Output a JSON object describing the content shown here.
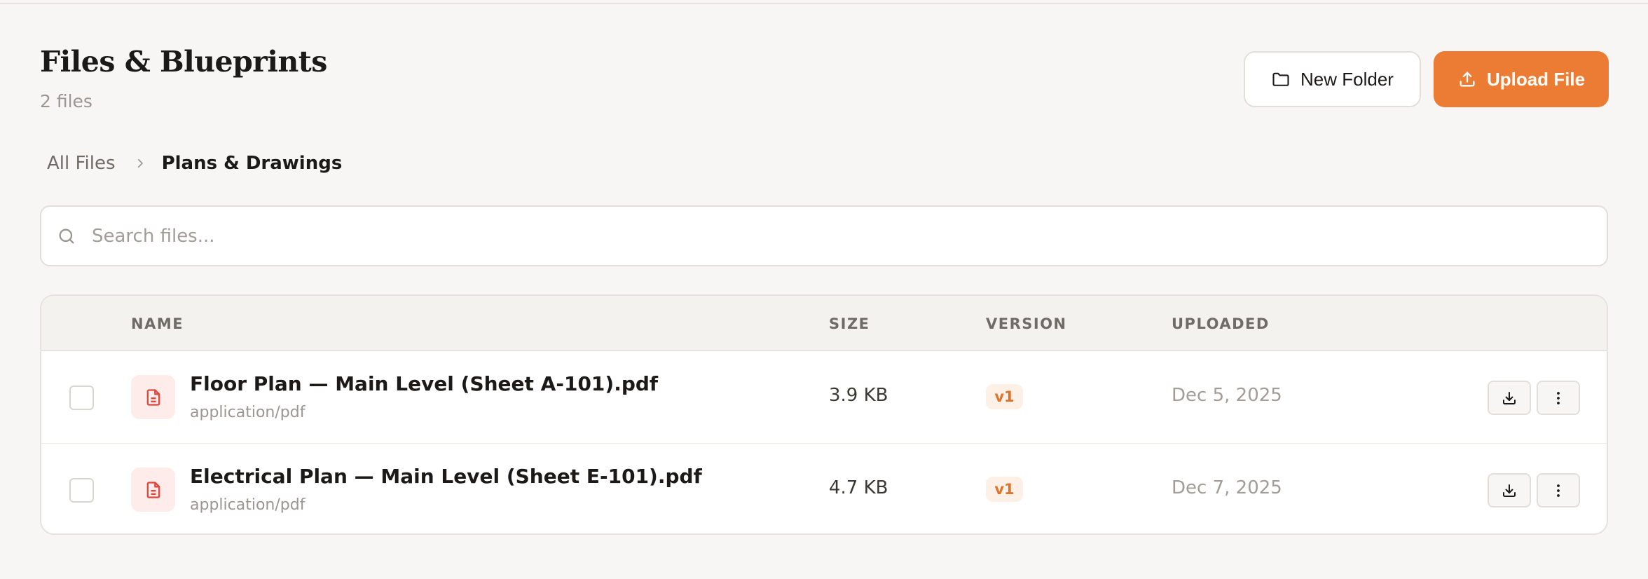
{
  "header": {
    "title": "Files & Blueprints",
    "subtitle": "2 files"
  },
  "toolbar": {
    "new_folder_label": "New Folder",
    "upload_label": "Upload File"
  },
  "breadcrumb": {
    "root": "All Files",
    "current": "Plans & Drawings"
  },
  "search": {
    "placeholder": "Search files..."
  },
  "table": {
    "columns": [
      "NAME",
      "SIZE",
      "VERSION",
      "UPLOADED"
    ],
    "rows": [
      {
        "name": "Floor Plan — Main Level (Sheet A-101).pdf",
        "type": "application/pdf",
        "size": "3.9 KB",
        "version": "v1",
        "uploaded": "Dec 5, 2025"
      },
      {
        "name": "Electrical Plan — Main Level (Sheet E-101).pdf",
        "type": "application/pdf",
        "size": "4.7 KB",
        "version": "v1",
        "uploaded": "Dec 7, 2025"
      }
    ]
  },
  "icons": {
    "folder": "folder-icon",
    "upload": "upload-icon",
    "chevron": "chevron-right-icon",
    "search": "search-icon",
    "file": "file-pdf-icon",
    "download": "download-icon",
    "more": "more-vertical-icon"
  },
  "colors": {
    "accent": "#ec7c33",
    "file_icon": "#e0463c",
    "background": "#f7f6f4"
  }
}
